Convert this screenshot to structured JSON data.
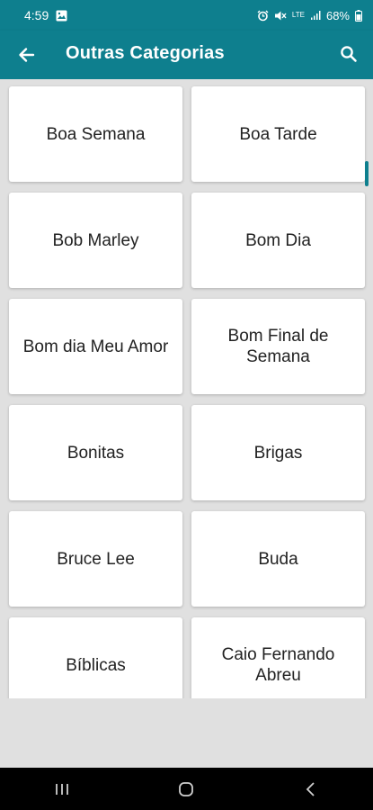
{
  "status_bar": {
    "time": "4:59",
    "battery": "68%",
    "network": "LTE"
  },
  "app_bar": {
    "title": "Outras Categorias"
  },
  "categories": [
    {
      "label": "Boa Semana"
    },
    {
      "label": "Boa Tarde"
    },
    {
      "label": "Bob Marley"
    },
    {
      "label": "Bom Dia"
    },
    {
      "label": "Bom dia Meu Amor"
    },
    {
      "label": "Bom Final de Semana"
    },
    {
      "label": "Bonitas"
    },
    {
      "label": "Brigas"
    },
    {
      "label": "Bruce Lee"
    },
    {
      "label": "Buda"
    },
    {
      "label": "Bíblicas"
    },
    {
      "label": "Caio Fernando Abreu"
    }
  ],
  "colors": {
    "primary": "#0e7f8e",
    "background": "#e0e0e0",
    "card": "#ffffff"
  },
  "icons": {
    "back": "arrow-left-icon",
    "search": "search-icon",
    "nav_recents": "recents-icon",
    "nav_home": "home-icon",
    "nav_back": "nav-back-icon"
  }
}
